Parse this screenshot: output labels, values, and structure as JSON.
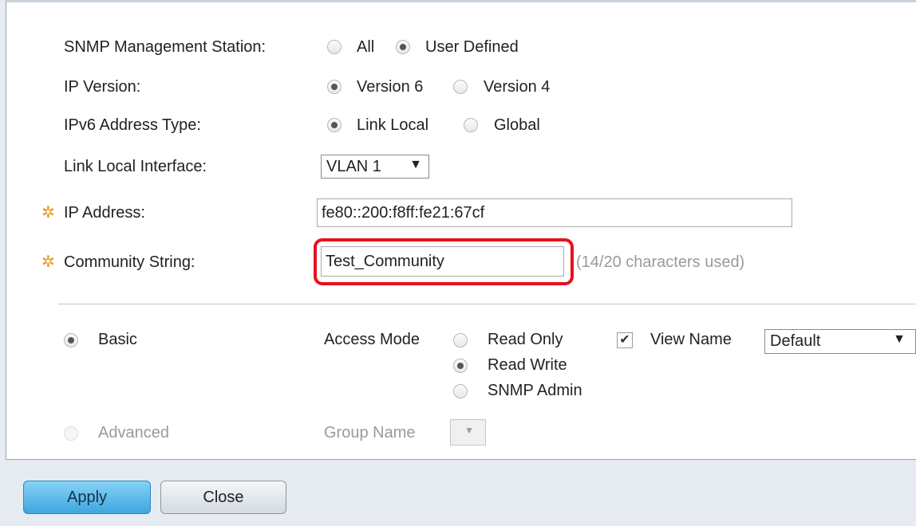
{
  "station": {
    "label": "SNMP Management Station:",
    "opt_all": "All",
    "opt_user": "User Defined",
    "selected": "User Defined"
  },
  "ip_version": {
    "label": "IP Version:",
    "opt_v6": "Version 6",
    "opt_v4": "Version 4",
    "selected": "Version 6"
  },
  "ipv6_type": {
    "label": "IPv6 Address Type:",
    "opt_link": "Link Local",
    "opt_global": "Global",
    "selected": "Link Local"
  },
  "link_local": {
    "label": "Link Local Interface:",
    "value": "VLAN 1"
  },
  "ip_address": {
    "label": "IP Address:",
    "value": "fe80::200:f8ff:fe21:67cf"
  },
  "community": {
    "label": "Community String:",
    "value": "Test_Community",
    "counter": "(14/20 characters used)"
  },
  "mode": {
    "basic_label": "Basic",
    "advanced_label": "Advanced",
    "selected": "Basic",
    "access_mode_label": "Access Mode",
    "read_only": "Read Only",
    "read_write": "Read Write",
    "snmp_admin": "SNMP Admin",
    "access_selected": "Read Write",
    "view_name_label": "View Name",
    "view_name_checked": true,
    "view_name_value": "Default",
    "group_name_label": "Group Name"
  },
  "buttons": {
    "apply": "Apply",
    "close": "Close"
  },
  "colors": {
    "required_icon": "#e79a1b",
    "highlight": "#e8101e",
    "apply_button": "#3ea6e0"
  }
}
